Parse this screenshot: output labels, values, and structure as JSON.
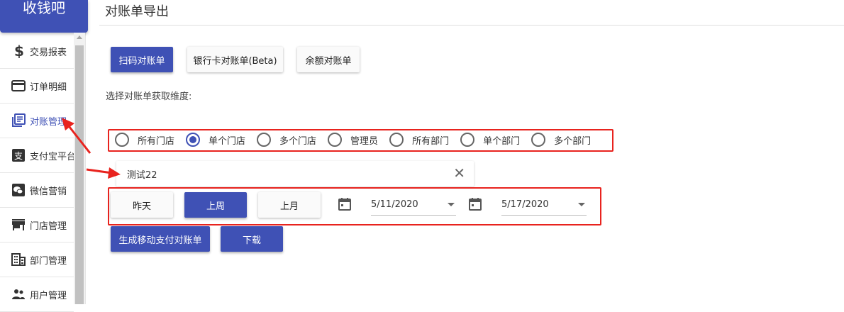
{
  "app": {
    "brand": "收钱吧"
  },
  "sidebar": {
    "items": [
      {
        "label": "交易报表",
        "icon": "dollar-icon",
        "active": false
      },
      {
        "label": "订单明细",
        "icon": "credit-card-icon",
        "active": false
      },
      {
        "label": "对账管理",
        "icon": "library-books-icon",
        "active": true
      },
      {
        "label": "支付宝平台",
        "icon": "alipay-icon",
        "active": false
      },
      {
        "label": "微信营销",
        "icon": "wechat-icon",
        "active": false
      },
      {
        "label": "门店管理",
        "icon": "store-icon",
        "active": false
      },
      {
        "label": "部门管理",
        "icon": "building-icon",
        "active": false
      },
      {
        "label": "用户管理",
        "icon": "people-icon",
        "active": false
      }
    ]
  },
  "page": {
    "title": "对账单导出"
  },
  "tabs": {
    "scan": "扫码对账单",
    "bank": "银行卡对账单(Beta)",
    "balance": "余额对账单"
  },
  "dimension": {
    "label": "选择对账单获取维度:",
    "options": [
      {
        "label": "所有门店",
        "checked": false
      },
      {
        "label": "单个门店",
        "checked": true
      },
      {
        "label": "多个门店",
        "checked": false
      },
      {
        "label": "管理员",
        "checked": false
      },
      {
        "label": "所有部门",
        "checked": false
      },
      {
        "label": "单个部门",
        "checked": false
      },
      {
        "label": "多个部门",
        "checked": false
      }
    ]
  },
  "store_select": {
    "value": "测试22",
    "clear_icon": "close-icon"
  },
  "range": {
    "yesterday": "昨天",
    "last_week": "上周",
    "last_month": "上月",
    "start_date": "5/11/2020",
    "end_date": "5/17/2020"
  },
  "actions": {
    "generate": "生成移动支付对账单",
    "download": "下载"
  },
  "colors": {
    "primary": "#3f51b5",
    "annotation_red": "#e8231e"
  }
}
